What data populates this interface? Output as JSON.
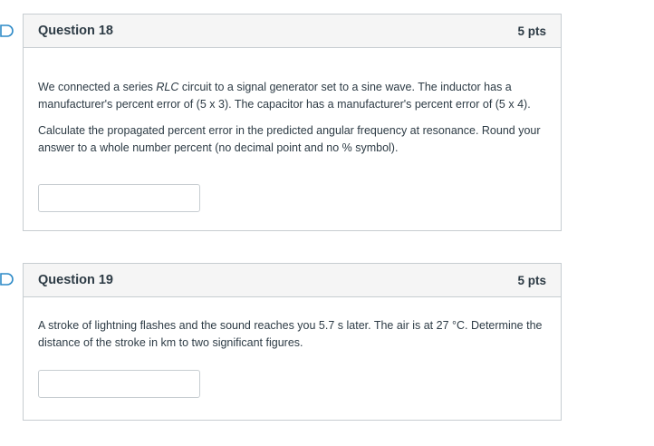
{
  "questions": [
    {
      "title": "Question 18",
      "points": "5 pts",
      "p1_a": "We connected a series ",
      "p1_em": "RLC",
      "p1_b": " circuit to a signal generator set to a sine wave.  The inductor has a manufacturer's percent error of (5 x 3).  The capacitor has a manufacturer's percent error of (5 x 4).",
      "p2": "Calculate the propagated percent error in the predicted angular frequency at resonance.  Round your answer to a whole number percent (no decimal point and no % symbol).",
      "answer_value": ""
    },
    {
      "title": "Question 19",
      "points": "5 pts",
      "p1": "A stroke of lightning flashes and the sound reaches you 5.7 s later.  The air is at 27 °C.  Determine the distance of the stroke in km to two significant figures.",
      "answer_value": ""
    }
  ],
  "colors": {
    "flag": "#2d8ac7",
    "border": "#c7cdd1",
    "header_bg": "#f5f5f5",
    "text": "#2d3b45"
  },
  "icons": {
    "flag": "bookmark-flag-icon"
  }
}
